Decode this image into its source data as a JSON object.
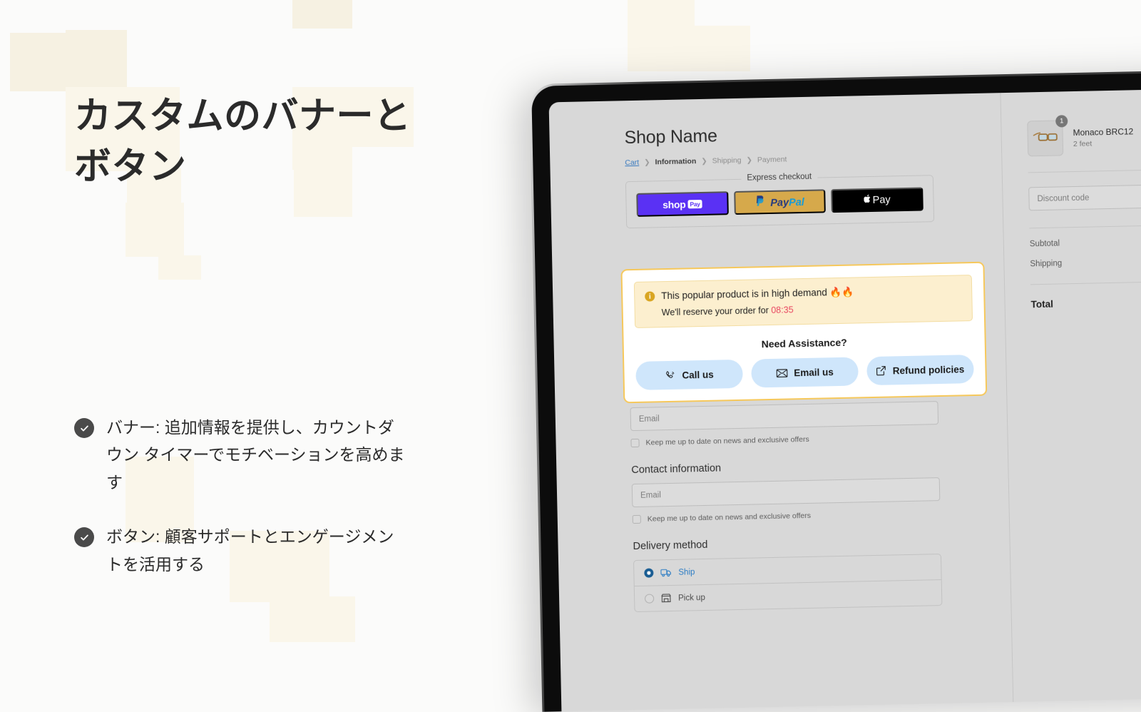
{
  "marketing": {
    "headline": "カスタムのバナーとボタン",
    "bullets": [
      {
        "text": "バナー: 追加情報を提供し、カウントダウン タイマーでモチベーションを高めます"
      },
      {
        "text": "ボタン: 顧客サポートとエンゲージメントを活用する"
      }
    ]
  },
  "checkout": {
    "shop_name": "Shop Name",
    "breadcrumb": [
      {
        "label": "Cart",
        "state": "link"
      },
      {
        "label": "Information",
        "state": "current"
      },
      {
        "label": "Shipping",
        "state": "muted"
      },
      {
        "label": "Payment",
        "state": "muted"
      }
    ],
    "breadcrumb_separator": "❯",
    "express": {
      "legend": "Express checkout",
      "buttons": [
        {
          "name": "shop-pay",
          "label": "shop",
          "chip": "Pay",
          "color": "#5a31f4"
        },
        {
          "name": "paypal",
          "label_dark": "Pay",
          "label_light": "Pal",
          "color": "#d6a94b"
        },
        {
          "name": "apple-pay",
          "label": "Pay",
          "color": "#000000"
        }
      ]
    },
    "promo": {
      "info_glyph": "i",
      "headline": "This popular product is in high demand 🔥🔥",
      "reserve_prefix": "We'll reserve your order for",
      "timer": "08:35",
      "timer_color": "#e8455f",
      "assistance_title": "Need Assistance?",
      "buttons": [
        {
          "label": "Call us",
          "icon": "phone-icon"
        },
        {
          "label": "Email us",
          "icon": "envelope-icon"
        },
        {
          "label": "Refund policies",
          "icon": "external-link-icon"
        }
      ],
      "border_color": "#f6c85b",
      "banner_bg": "#fcefcf",
      "button_bg": "#cfe6fb"
    },
    "form": {
      "email_placeholder_1": "Email",
      "newsletter_label_1": "Keep me up to date on news and exclusive offers",
      "contact_heading": "Contact information",
      "email_placeholder_2": "Email",
      "newsletter_label_2": "Keep me up to date on news and exclusive offers",
      "delivery_heading": "Delivery method",
      "delivery_options": [
        {
          "label": "Ship",
          "icon": "truck-icon",
          "selected": true
        },
        {
          "label": "Pick up",
          "icon": "store-icon",
          "selected": false
        }
      ]
    },
    "summary": {
      "product": {
        "title": "Monaco BRC12",
        "variant": "2 feet",
        "quantity": "1",
        "thumbnail_icon": "sunglasses-icon"
      },
      "discount_placeholder": "Discount code",
      "rows": [
        {
          "label": "Subtotal",
          "value": ""
        },
        {
          "label": "Shipping",
          "value": ""
        }
      ],
      "total_label": "Total",
      "total_value": ""
    }
  }
}
